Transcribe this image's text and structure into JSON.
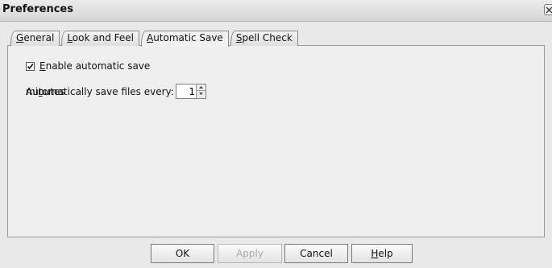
{
  "window": {
    "title": "Preferences"
  },
  "tabs": [
    {
      "mnemonic": "G",
      "rest": "eneral",
      "active": false
    },
    {
      "mnemonic": "L",
      "rest": "ook and Feel",
      "active": false
    },
    {
      "mnemonic": "A",
      "rest": "utomatic Save",
      "active": true
    },
    {
      "mnemonic": "S",
      "rest": "pell Check",
      "active": false
    }
  ],
  "autosave": {
    "enable_mnemonic": "E",
    "enable_rest": "nable automatic save",
    "enabled": true,
    "interval_prefix": "Au",
    "interval_mnemonic": "t",
    "interval_rest": "omatically save files every:",
    "interval_value": "1",
    "interval_unit": "minutes"
  },
  "buttons": {
    "ok": "OK",
    "apply": "Apply",
    "cancel": "Cancel",
    "help_mnemonic": "H",
    "help_rest": "elp"
  }
}
